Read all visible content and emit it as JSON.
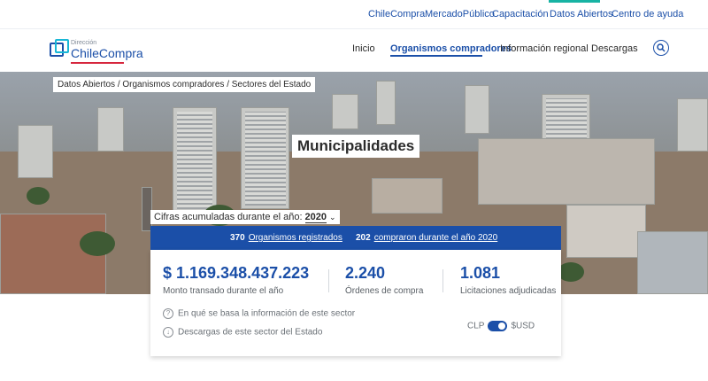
{
  "topbar": {
    "items": [
      "ChileCompra",
      "MercadoPúblico",
      "Capacitación",
      "Datos Abiertos",
      "Centro de ayuda"
    ],
    "active": "Datos Abiertos"
  },
  "logo": {
    "small": "Dirección",
    "big": "ChileCompra"
  },
  "nav": {
    "items": [
      "Inicio",
      "Organismos compradores",
      "Información regional",
      "Descargas"
    ],
    "active": "Organismos compradores"
  },
  "breadcrumb": "Datos Abiertos / Organismos compradores / Sectores del Estado",
  "page_title": "Municipalidades",
  "year_selector": {
    "label": "Cifras acumuladas durante el año:",
    "value": "2020"
  },
  "summary": {
    "registered_count": "370",
    "registered_label": "Organismos registrados",
    "bought_count": "202",
    "bought_label": "compraron durante el año 2020"
  },
  "stats": [
    {
      "value": "$ 1.169.348.437.223",
      "label": "Monto transado durante el año"
    },
    {
      "value": "2.240",
      "label": "Órdenes de compra"
    },
    {
      "value": "1.081",
      "label": "Licitaciones adjudicadas"
    }
  ],
  "links": {
    "info": "En qué se basa la información de este sector",
    "downloads": "Descargas de este sector del Estado"
  },
  "currency_toggle": {
    "left": "CLP",
    "right": "$USD",
    "on": true
  },
  "colors": {
    "primary": "#1b4fa8",
    "accent": "#17b3a3",
    "brand_red": "#d6263d"
  }
}
